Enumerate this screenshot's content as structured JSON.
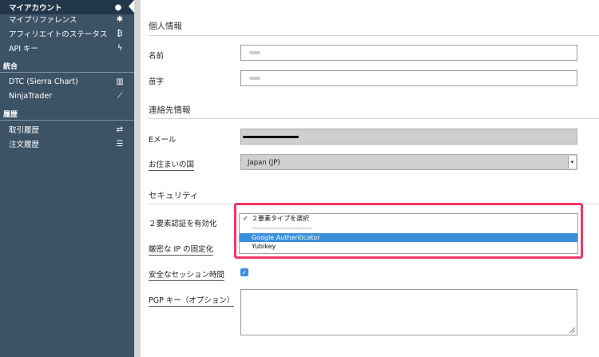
{
  "sidebar": {
    "account_items": [
      {
        "label": "マイアカウント",
        "icon": "user-icon",
        "glyph": "●"
      },
      {
        "label": "マイプリファレンス",
        "icon": "gear-icon",
        "glyph": "✱"
      },
      {
        "label": "アフィリエイトのステータス",
        "icon": "bitcoin-icon",
        "glyph": "₿"
      },
      {
        "label": "API キー",
        "icon": "bolt-icon",
        "glyph": "ϟ"
      }
    ],
    "integration_heading": "統合",
    "integration_items": [
      {
        "label": "DTC (Sierra Chart)",
        "icon": "bar-chart-icon",
        "glyph": "▥"
      },
      {
        "label": "NinjaTrader",
        "icon": "line-chart-icon",
        "glyph": "⟋"
      }
    ],
    "history_heading": "履歴",
    "history_items": [
      {
        "label": "取引履歴",
        "icon": "exchange-icon",
        "glyph": "⇄"
      },
      {
        "label": "注文履歴",
        "icon": "list-icon",
        "glyph": "☰"
      }
    ]
  },
  "main": {
    "personal_heading": "個人情報",
    "first_name_label": "名前",
    "last_name_label": "苗字",
    "contact_heading": "連絡先情報",
    "email_label": "Eメール",
    "country_label": "お住まいの国",
    "country_value": "Japan (JP)",
    "security_heading": "セキュリティ",
    "twofa_label": "２要素認証を有効化",
    "strict_ip_label": "厳密な IP の固定化",
    "secure_session_label": "安全なセッション時間",
    "pgp_label": "PGP キー（オプション）",
    "twofa_dropdown": {
      "selected": "２要素タイプを選択",
      "separator": "--------------------------",
      "options": [
        "Google Authenticator",
        "Yubikey"
      ]
    }
  },
  "colors": {
    "sidebar_bg": "#3c5366",
    "sidebar_active": "#22384a",
    "highlight_border": "#f0386b",
    "option_highlight": "#3a8fdb"
  }
}
